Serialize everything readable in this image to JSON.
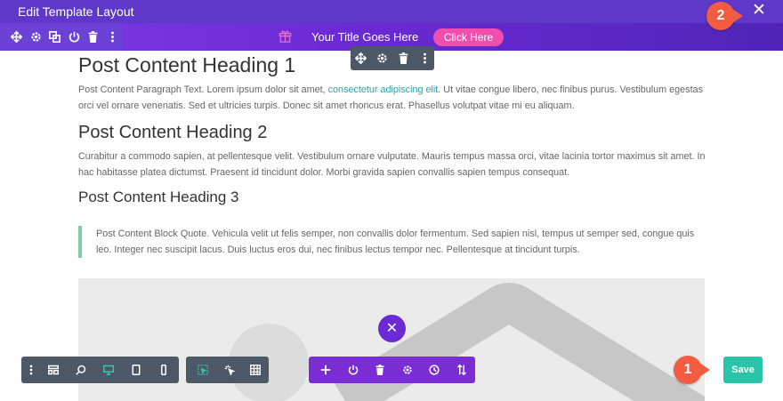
{
  "window": {
    "title": "Edit Template Layout",
    "close_icon": "close-icon"
  },
  "section_toolbar": {
    "icons": [
      "move-icon",
      "settings-icon",
      "duplicate-icon",
      "power-icon",
      "trash-icon",
      "more-icon"
    ]
  },
  "header": {
    "gift_icon": "gift-icon",
    "title": "Your Title Goes Here",
    "button_label": "Click Here",
    "button_color": "#f04fb0",
    "bar_color": "#6b2ad3"
  },
  "module_toolbar": {
    "icons": [
      "move-icon",
      "settings-icon",
      "trash-icon",
      "more-icon"
    ]
  },
  "content": {
    "heading1": "Post Content Heading 1",
    "para1_before": "Post Content Paragraph Text. Lorem ipsum dolor sit amet, ",
    "para1_link": "consectetur adipiscing elit",
    "para1_after": ". Ut vitae congue libero, nec finibus purus. Vestibulum egestas orci vel ornare venenatis. Sed et ultricies turpis. Donec sit amet rhoncus erat. Phasellus volutpat vitae mi eu aliquam.",
    "heading2": "Post Content Heading 2",
    "para2": "Curabitur a commodo sapien, at pellentesque velit. Vestibulum ornare vulputate. Mauris tempus massa orci, vitae lacinia tortor maximus sit amet. In hac habitasse platea dictumst. Praesent id tincidunt dolor. Morbi gravida sapien convallis sapien tempus consequat.",
    "heading3": "Post Content Heading 3",
    "quote": "Post Content Block Quote. Vehicula velit ut felis semper, non convallis dolor fermentum. Sed sapien nisl, tempus ut semper sed, congue quis leo. Integer nec suscipit lacus. Duis luctus eros dui, nec finibus lectus tempor nec. Pellentesque at tincidunt turpis.",
    "link_color": "#2ea3a3",
    "quote_border_color": "#7fcfa5"
  },
  "image_placeholder": {
    "icon": "image-placeholder-icon"
  },
  "bottom_left_toolbar": {
    "icons": [
      "more-icon",
      "layout-icon",
      "zoom-icon",
      "desktop-icon",
      "tablet-icon",
      "phone-icon"
    ],
    "active": "desktop-icon"
  },
  "bottom_mid_toolbar": {
    "icons": [
      "select-icon",
      "click-mode-icon",
      "grid-icon"
    ]
  },
  "bottom_purple_toolbar": {
    "icons": [
      "add-icon",
      "power-icon",
      "trash-icon",
      "settings-icon",
      "history-icon",
      "sort-icon"
    ]
  },
  "close_fab": {
    "icon": "close-icon",
    "color": "#6b2ad3"
  },
  "save": {
    "label": "Save",
    "color": "#29c4a9"
  },
  "markers": {
    "m1": "1",
    "m2": "2",
    "color": "#f25c40"
  }
}
